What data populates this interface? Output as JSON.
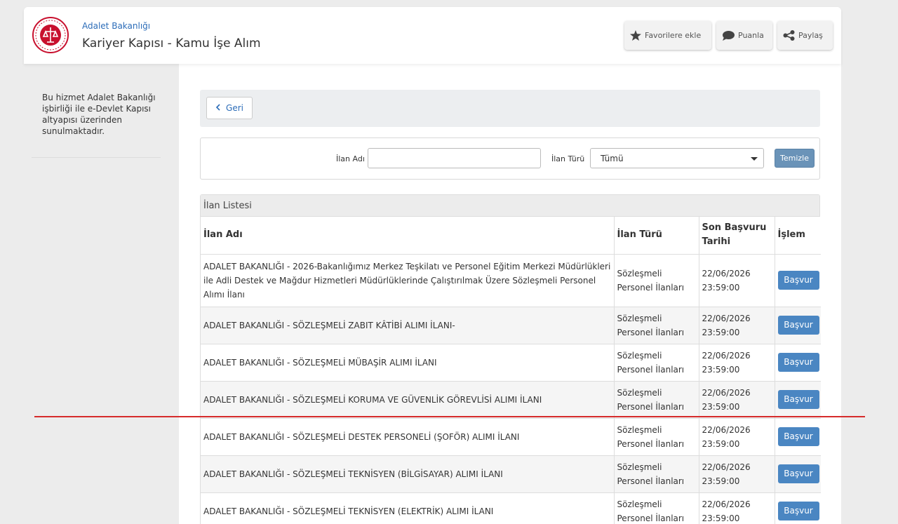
{
  "header": {
    "ministry": "Adalet Bakanlığı",
    "title": "Kariyer Kapısı - Kamu İşe Alım",
    "favorite_label": "Favorilere ekle",
    "rate_label": "Puanla",
    "share_label": "Paylaş"
  },
  "sidebar": {
    "note": "Bu hizmet Adalet Bakanlığı işbirliği ile e-Devlet Kapısı altyapısı üzerinden sunulmaktadır."
  },
  "back": {
    "label": "Geri"
  },
  "filters": {
    "name_label": "İlan Adı",
    "name_value": "",
    "type_label": "İlan Türü",
    "type_selected": "Tümü",
    "clear_label": "Temizle"
  },
  "list": {
    "caption": "İlan Listesi",
    "columns": [
      "İlan Adı",
      "İlan Türü",
      "Son Başvuru Tarihi",
      "İşlem"
    ],
    "rows": [
      {
        "name": "ADALET BAKANLIĞI - 2026-Bakanlığımız Merkez Teşkilatı ve Personel Eğitim Merkezi Müdürlükleri ile Adli Destek ve Mağdur Hizmetleri Müdürlüklerinde Çalıştırılmak Üzere Sözleşmeli Personel Alımı İlanı",
        "type": "Sözleşmeli Personel İlanları",
        "deadline": "22/06/2026 23:59:00",
        "action": "Başvur"
      },
      {
        "name": "ADALET BAKANLIĞI - SÖZLEŞMELİ ZABIT KÂTİBİ ALIMI İLANI-",
        "type": "Sözleşmeli Personel İlanları",
        "deadline": "22/06/2026 23:59:00",
        "action": "Başvur"
      },
      {
        "name": "ADALET BAKANLIĞI - SÖZLEŞMELİ MÜBAŞİR ALIMI İLANI",
        "type": "Sözleşmeli Personel İlanları",
        "deadline": "22/06/2026 23:59:00",
        "action": "Başvur"
      },
      {
        "name": "ADALET BAKANLIĞI - SÖZLEŞMELİ KORUMA VE GÜVENLİK GÖREVLİSİ ALIMI İLANI",
        "type": "Sözleşmeli Personel İlanları",
        "deadline": "22/06/2026 23:59:00",
        "action": "Başvur"
      },
      {
        "name": "ADALET BAKANLIĞI - SÖZLEŞMELİ DESTEK PERSONELİ (ŞOFÖR) ALIMI İLANI",
        "type": "Sözleşmeli Personel İlanları",
        "deadline": "22/06/2026 23:59:00",
        "action": "Başvur"
      },
      {
        "name": "ADALET BAKANLIĞI - SÖZLEŞMELİ TEKNİSYEN (BİLGİSAYAR) ALIMI İLANI",
        "type": "Sözleşmeli Personel İlanları",
        "deadline": "22/06/2026 23:59:00",
        "action": "Başvur"
      },
      {
        "name": "ADALET BAKANLIĞI - SÖZLEŞMELİ TEKNİSYEN (ELEKTRİK) ALIMI İLANI",
        "type": "Sözleşmeli Personel İlanları",
        "deadline": "22/06/2026 23:59:00",
        "action": "Başvur"
      }
    ]
  },
  "icons": {
    "logo": "ministry-seal-icon",
    "favorite": "star-icon",
    "rate": "speech-bubble-icon",
    "share": "share-icon",
    "back": "chevron-left-icon",
    "select": "caret-down-icon"
  },
  "colors": {
    "accent": "#2b6cb8",
    "button": "#4a86c2",
    "logo_red": "#c8102e",
    "annotation_line": "#d62b2b"
  }
}
